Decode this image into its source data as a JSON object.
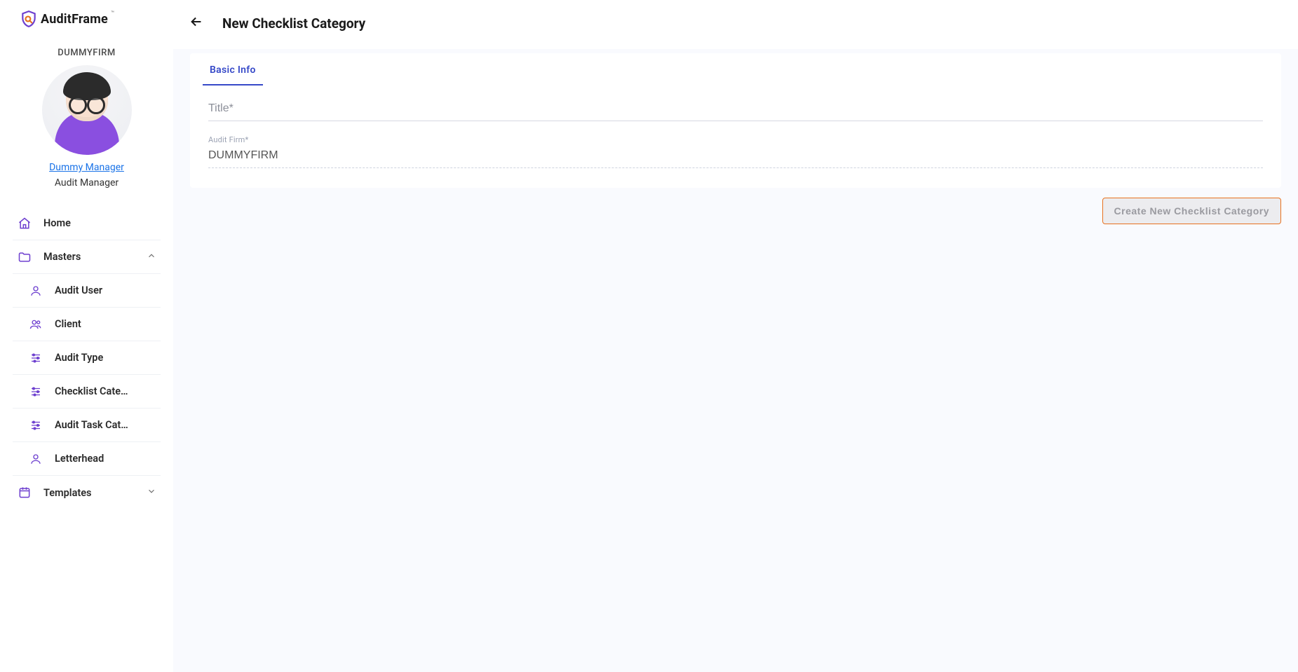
{
  "brand": {
    "name": "AuditFrame",
    "tm": "™"
  },
  "firm": {
    "code": "DUMMYFIRM"
  },
  "user": {
    "name": "Dummy Manager",
    "role": "Audit Manager"
  },
  "nav": {
    "home": "Home",
    "masters": "Masters",
    "sub": {
      "audit_user": "Audit User",
      "client": "Client",
      "audit_type": "Audit Type",
      "checklist_cat": "Checklist Cate…",
      "audit_task_cat": "Audit Task Cat…",
      "letterhead": "Letterhead"
    },
    "templates": "Templates"
  },
  "page": {
    "title": "New Checklist Category",
    "tab_basic": "Basic Info",
    "title_label": "Title*",
    "audit_firm_label": "Audit Firm*",
    "audit_firm_value": "DUMMYFIRM",
    "create_btn": "Create New Checklist Category"
  }
}
